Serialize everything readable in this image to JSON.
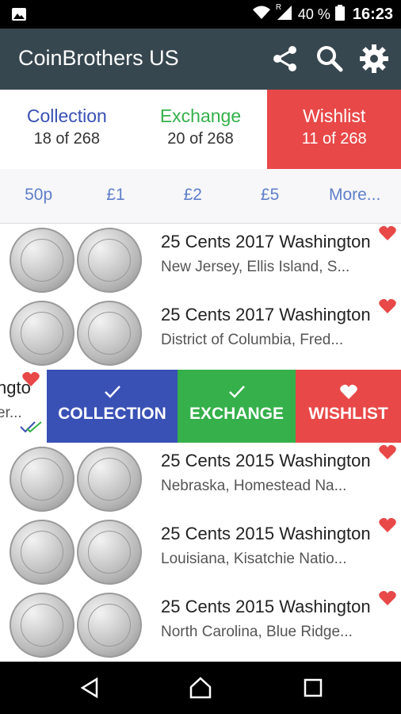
{
  "status_bar": {
    "battery": "40 %",
    "time": "16:23",
    "roaming": "R"
  },
  "app_bar": {
    "title": "CoinBrothers US",
    "icons": [
      "share-icon",
      "search-icon",
      "gear-icon"
    ]
  },
  "counters": [
    {
      "label": "Collection",
      "count": "18 of 268"
    },
    {
      "label": "Exchange",
      "count": "20 of 268"
    },
    {
      "label": "Wishlist",
      "count": "11 of 268"
    }
  ],
  "tabs": [
    "50p",
    "£1",
    "£2",
    "£5",
    "More..."
  ],
  "items": [
    {
      "title": "25 Cents 2017 Washington",
      "subtitle": "New Jersey, Ellis Island, S..."
    },
    {
      "title": "25 Cents 2017 Washington",
      "subtitle": "District of Columbia, Fred..."
    },
    {
      "title": "25 Cents 2015 Washington",
      "subtitle": "Nebraska, Homestead Na..."
    },
    {
      "title": "25 Cents 2015 Washington",
      "subtitle": "Louisiana, Kisatchie Natio..."
    },
    {
      "title": "25 Cents 2015 Washington",
      "subtitle": "North Carolina, Blue Ridge..."
    }
  ],
  "swiped_item": {
    "title_fragment": "ngto",
    "subtitle_fragment": "er..."
  },
  "actions": {
    "collection": "COLLECTION",
    "exchange": "EXCHANGE",
    "wishlist": "WISHLIST"
  },
  "colors": {
    "appbar": "#37474f",
    "collection": "#3950b5",
    "exchange": "#35b04a",
    "wishlist": "#e84848",
    "tab_text": "#5f7fc9"
  }
}
